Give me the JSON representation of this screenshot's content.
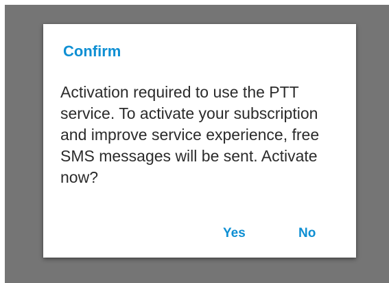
{
  "colors": {
    "accent": "#0e8fd3",
    "scrim": "#757575",
    "dialog_background": "#ffffff",
    "message_text": "#2b2b2b"
  },
  "dialog": {
    "title": "Confirm",
    "message": "Activation required to use the PTT service. To activate your subscription and improve service experience, free SMS messages will be sent. Activate now?",
    "positive_label": "Yes",
    "negative_label": "No"
  }
}
